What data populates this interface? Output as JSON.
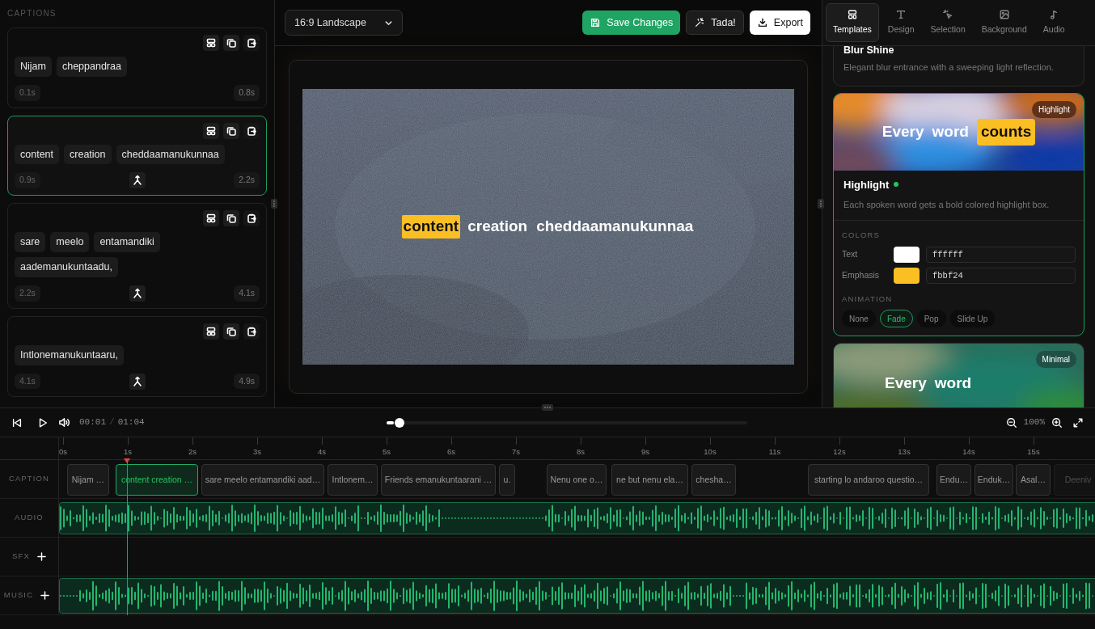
{
  "captions_panel": {
    "heading": "CAPTIONS",
    "cards": [
      {
        "words": [
          "Nijam",
          "cheppandraa"
        ],
        "start": "0.1s",
        "end": "0.8s",
        "selected": false,
        "merge": false
      },
      {
        "words": [
          "content",
          "creation",
          "cheddaamanukunnaa"
        ],
        "start": "0.9s",
        "end": "2.2s",
        "selected": true,
        "merge": true
      },
      {
        "words": [
          "sare",
          "meelo",
          "entamandiki",
          "aademanukuntaadu,"
        ],
        "start": "2.2s",
        "end": "4.1s",
        "selected": false,
        "merge": true
      },
      {
        "words": [
          "Intlonemanukuntaaru,"
        ],
        "start": "4.1s",
        "end": "4.9s",
        "selected": false,
        "merge": true
      }
    ]
  },
  "toolbar": {
    "aspect": "16:9 Landscape",
    "buttons": [
      {
        "kind": "primary",
        "label": "Save Changes"
      },
      {
        "kind": "secondary",
        "label": "Tada!"
      },
      {
        "kind": "light",
        "label": "Export"
      }
    ]
  },
  "preview": {
    "words": [
      {
        "text": "content",
        "highlighted": true
      },
      {
        "text": "creation",
        "highlighted": false
      },
      {
        "text": "cheddaamanukunnaa",
        "highlighted": false
      }
    ]
  },
  "inspector": {
    "tabs": [
      {
        "label": "Templates",
        "selected": true
      },
      {
        "label": "Design",
        "selected": false
      },
      {
        "label": "Selection",
        "selected": false
      },
      {
        "label": "Background",
        "selected": false
      },
      {
        "label": "Audio",
        "selected": false
      }
    ],
    "templates": [
      {
        "kind": "plain",
        "name": "Blur Shine",
        "description": "Elegant blur entrance with a sweeping light reflection.",
        "selected": false
      },
      {
        "kind": "full",
        "badge": "Highlight",
        "sample": [
          {
            "text": "Every",
            "highlighted": false
          },
          {
            "text": "word",
            "highlighted": false
          },
          {
            "text": "counts",
            "highlighted": true
          }
        ],
        "name": "Highlight",
        "description": "Each spoken word gets a bold colored highlight box.",
        "selected": true,
        "colors_heading": "COLORS",
        "colors": [
          {
            "label": "Text",
            "color": "#ffffff",
            "value": "ffffff"
          },
          {
            "label": "Emphasis",
            "color": "#fbbf24",
            "value": "fbbf24"
          }
        ],
        "animation_heading": "ANIMATION",
        "animations": [
          {
            "label": "None",
            "selected": false
          },
          {
            "label": "Fade",
            "selected": true
          },
          {
            "label": "Pop",
            "selected": false
          },
          {
            "label": "Slide Up",
            "selected": false
          }
        ]
      },
      {
        "kind": "preview",
        "badge": "Minimal",
        "sample": [
          {
            "text": "Every",
            "highlighted": false
          },
          {
            "text": "word",
            "highlighted": false
          }
        ],
        "selected": false
      }
    ]
  },
  "transport": {
    "current": "00:01",
    "separator": "/",
    "duration": "01:04",
    "level": 0.02,
    "zoom": "100%"
  },
  "timeline": {
    "ticks": [
      "0s",
      "1s",
      "2s",
      "3s",
      "4s",
      "5s",
      "6s",
      "7s",
      "8s",
      "9s",
      "10s",
      "11s",
      "12s",
      "13s",
      "14s",
      "15s"
    ],
    "tracks": [
      {
        "label": "CAPTION",
        "kind": "caption"
      },
      {
        "label": "AUDIO",
        "kind": "audio"
      },
      {
        "label": "SFX",
        "kind": "sfx"
      },
      {
        "label": "MUSIC",
        "kind": "music"
      }
    ],
    "clips": [
      {
        "text": "Nijam …",
        "selected": false
      },
      {
        "text": "content creation …",
        "selected": true
      },
      {
        "text": "sare meelo entamandiki aad…",
        "selected": false
      },
      {
        "text": "Intlonem…",
        "selected": false
      },
      {
        "text": "Friends emanukuntaarani …",
        "selected": false
      },
      {
        "text": "u.",
        "selected": false
      },
      {
        "text": "Nenu one o…",
        "selected": false
      },
      {
        "text": "ne but nenu ela…",
        "selected": false
      },
      {
        "text": "chesha…",
        "selected": false
      },
      {
        "text": "starting lo andaroo questio…",
        "selected": false
      },
      {
        "text": "Endu…",
        "selected": false
      },
      {
        "text": "Enduk…",
        "selected": false
      },
      {
        "text": "Asal…",
        "selected": false
      },
      {
        "text": "Deeniv",
        "selected": false
      }
    ]
  }
}
